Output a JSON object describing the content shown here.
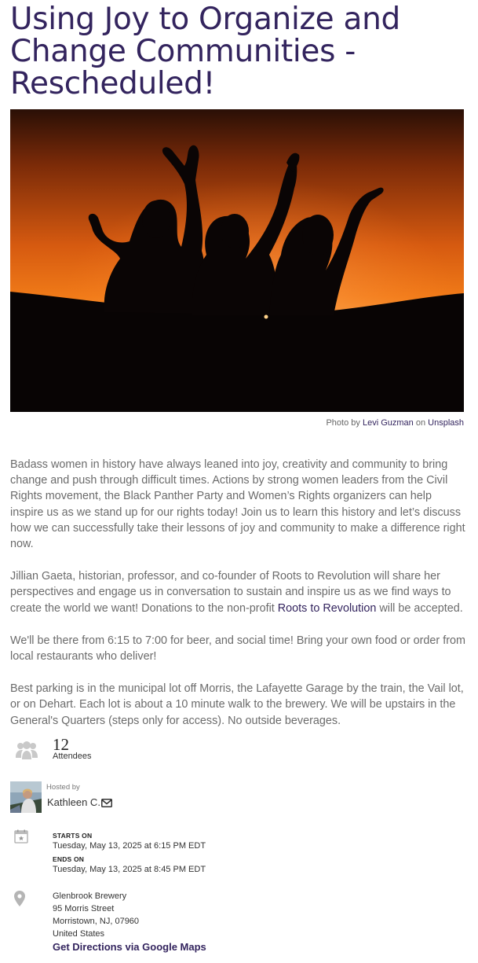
{
  "event": {
    "title": "Using Joy to Organize and Change Communities - Rescheduled!"
  },
  "photo": {
    "credit_prefix": "Photo by",
    "photographer": "Levi Guzman",
    "on": "on",
    "source": "Unsplash"
  },
  "description": {
    "p1": "Badass women in history have always leaned into joy, creativity and community to bring change and push through difficult times. Actions by strong women leaders from the Civil Rights movement, the Black Panther Party and Women’s Rights organizers can help inspire us as we stand up for our rights today! Join us to learn this history and let’s discuss how we can successfully take their lessons of joy and community to make a difference right now.",
    "p2_before": "Jillian Gaeta, historian, professor, and co-founder of Roots to Revolution will share her perspectives and engage us in conversation to sustain and inspire us as we find ways to create the world we want! Donations to the non-profit ",
    "p2_link": "Roots to Revolution",
    "p2_after": " will be accepted.",
    "p3": "We'll be there from 6:15 to 7:00 for beer, and social time!  Bring your own food or order from local restaurants who deliver!",
    "p4": "Best parking is in the municipal lot off Morris, the Lafayette Garage by the train, the Vail lot, or on Dehart.  Each lot is about a 10 minute walk to the brewery.  We will be upstairs in the General's Quarters (steps only for access). No outside beverages."
  },
  "attendees": {
    "count": "12",
    "label": "Attendees",
    "icon": "people-group-icon"
  },
  "host": {
    "hosted_by_label": "Hosted by",
    "name": "Kathleen C.",
    "contact_icon": "envelope-icon"
  },
  "schedule": {
    "icon": "calendar-icon",
    "starts_label": "STARTS ON",
    "starts_value": "Tuesday, May 13, 2025 at 6:15 PM EDT",
    "ends_label": "ENDS ON",
    "ends_value": "Tuesday, May 13, 2025 at 8:45 PM EDT"
  },
  "location": {
    "icon": "map-pin-icon",
    "venue": "Glenbrook Brewery",
    "street": "95 Morris Street",
    "city_line": "Morristown, NJ, 07960",
    "country": "United States",
    "directions_label": "Get Directions via Google Maps"
  },
  "colors": {
    "brand_purple": "#33245e",
    "body_text": "#6b6b6b"
  }
}
